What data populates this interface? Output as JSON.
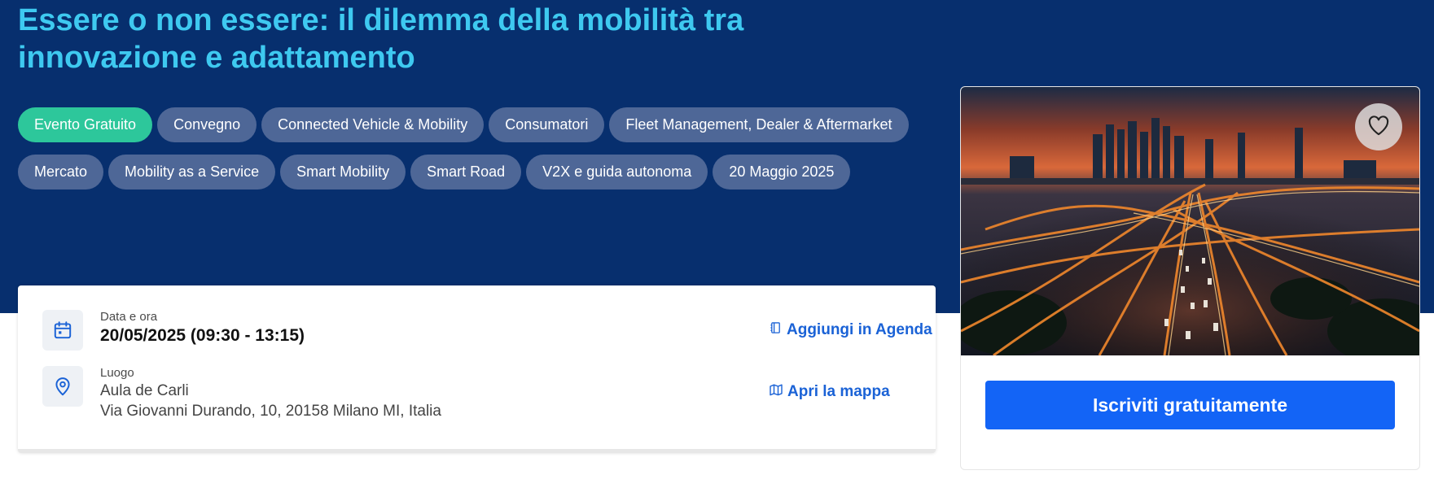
{
  "event": {
    "title": "Essere o non essere: il dilemma della mobilità tra innovazione e adattamento"
  },
  "tags": [
    "Evento Gratuito",
    "Convegno",
    "Connected Vehicle & Mobility",
    "Consumatori",
    "Fleet Management, Dealer & Aftermarket",
    "Mercato",
    "Mobility as a Service",
    "Smart Mobility",
    "Smart Road",
    "V2X e guida autonoma",
    "20 Maggio 2025"
  ],
  "info": {
    "date_label": "Data e ora",
    "date_value": "20/05/2025 (09:30 - 13:15)",
    "agenda_link": "Aggiungi in Agenda",
    "location_label": "Luogo",
    "location_name": "Aula de Carli",
    "location_address": "Via Giovanni Durando, 10, 20158 Milano MI, Italia",
    "map_link": "Apri la mappa"
  },
  "sidebar": {
    "cta_label": "Iscriviti gratuitamente"
  },
  "icons": {
    "calendar": "calendar-icon",
    "location": "location-pin-icon",
    "agenda": "agenda-book-icon",
    "map": "map-icon",
    "favorite": "heart-icon"
  },
  "colors": {
    "hero_bg": "#072f6e",
    "title": "#3ec9f0",
    "tag_free": "#2dc79b",
    "tag": "#4e6797",
    "link": "#1a62d6",
    "cta": "#1364f6"
  }
}
